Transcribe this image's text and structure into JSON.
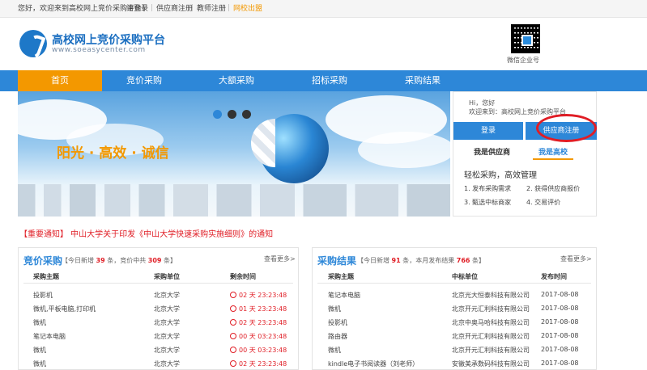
{
  "topbar": {
    "greeting": "您好，欢迎来到高校网上竞价采购平台！",
    "login": "请登录",
    "supplier_register": "供应商注册",
    "teacher_register": "教师注册",
    "campus_portal": "网校出盟"
  },
  "header": {
    "title": "高校网上竞价采购平台",
    "url": "www.soeasycenter.com",
    "qr_label": "微信企业号"
  },
  "nav": [
    "首页",
    "竞价采购",
    "大额采购",
    "招标采购",
    "采购结果"
  ],
  "banner": {
    "slogan": "阳光 · 高效 · 诚信"
  },
  "panel": {
    "hi": "Hi，您好",
    "welcome": "欢迎来到：高校网上竞价采购平台",
    "login_btn": "登录",
    "register_btn": "供应商注册",
    "tab_supplier": "我是供应商",
    "tab_school": "我是高校",
    "slogan": "轻松采购，高效管理",
    "steps": [
      "1. 发布采购需求",
      "2. 获得供应商报价",
      "3. 甄选中标商家",
      "4. 交易评价"
    ]
  },
  "notice": "【重要通知】 中山大学关于印发《中山大学快速采购实施细则》的通知",
  "bidding": {
    "title": "竞价采购",
    "stats_pre": "【今日新增",
    "new_count": "39",
    "stats_mid": "条，竞价中共",
    "active_count": "309",
    "stats_post": "条】",
    "more": "查看更多>",
    "headers": [
      "采购主题",
      "采购单位",
      "剩余时间"
    ],
    "rows": [
      {
        "subject": "投影机",
        "unit": "北京大学",
        "remaining": "02 天 23:23:48"
      },
      {
        "subject": "微机,平板电脑,打印机",
        "unit": "北京大学",
        "remaining": "01 天 23:23:48"
      },
      {
        "subject": "微机",
        "unit": "北京大学",
        "remaining": "02 天 23:23:48"
      },
      {
        "subject": "笔记本电脑",
        "unit": "北京大学",
        "remaining": "00 天 03:23:48"
      },
      {
        "subject": "微机",
        "unit": "北京大学",
        "remaining": "00 天 03:23:48"
      },
      {
        "subject": "微机",
        "unit": "北京大学",
        "remaining": "02 天 23:23:48"
      }
    ]
  },
  "results": {
    "title": "采购结果",
    "stats_pre": "【今日新增",
    "new_count": "91",
    "stats_mid": "条，本月发布结果",
    "month_count": "766",
    "stats_post": "条】",
    "more": "查看更多>",
    "headers": [
      "采购主题",
      "中标单位",
      "发布时间"
    ],
    "rows": [
      {
        "subject": "笔记本电脑",
        "winner": "北京光大恒泰科技有限公司",
        "date": "2017-08-08"
      },
      {
        "subject": "微机",
        "winner": "北京开元汇利科技有限公司",
        "date": "2017-08-08"
      },
      {
        "subject": "投影机",
        "winner": "北京中奥马哈科技有限公司",
        "date": "2017-08-08"
      },
      {
        "subject": "路由器",
        "winner": "北京开元汇利科技有限公司",
        "date": "2017-08-08"
      },
      {
        "subject": "微机",
        "winner": "北京开元汇利科技有限公司",
        "date": "2017-08-08"
      },
      {
        "subject": "kindle电子书阅读器（刘老师）",
        "winner": "安徽美承数码科技有限公司",
        "date": "2017-08-08"
      }
    ]
  }
}
